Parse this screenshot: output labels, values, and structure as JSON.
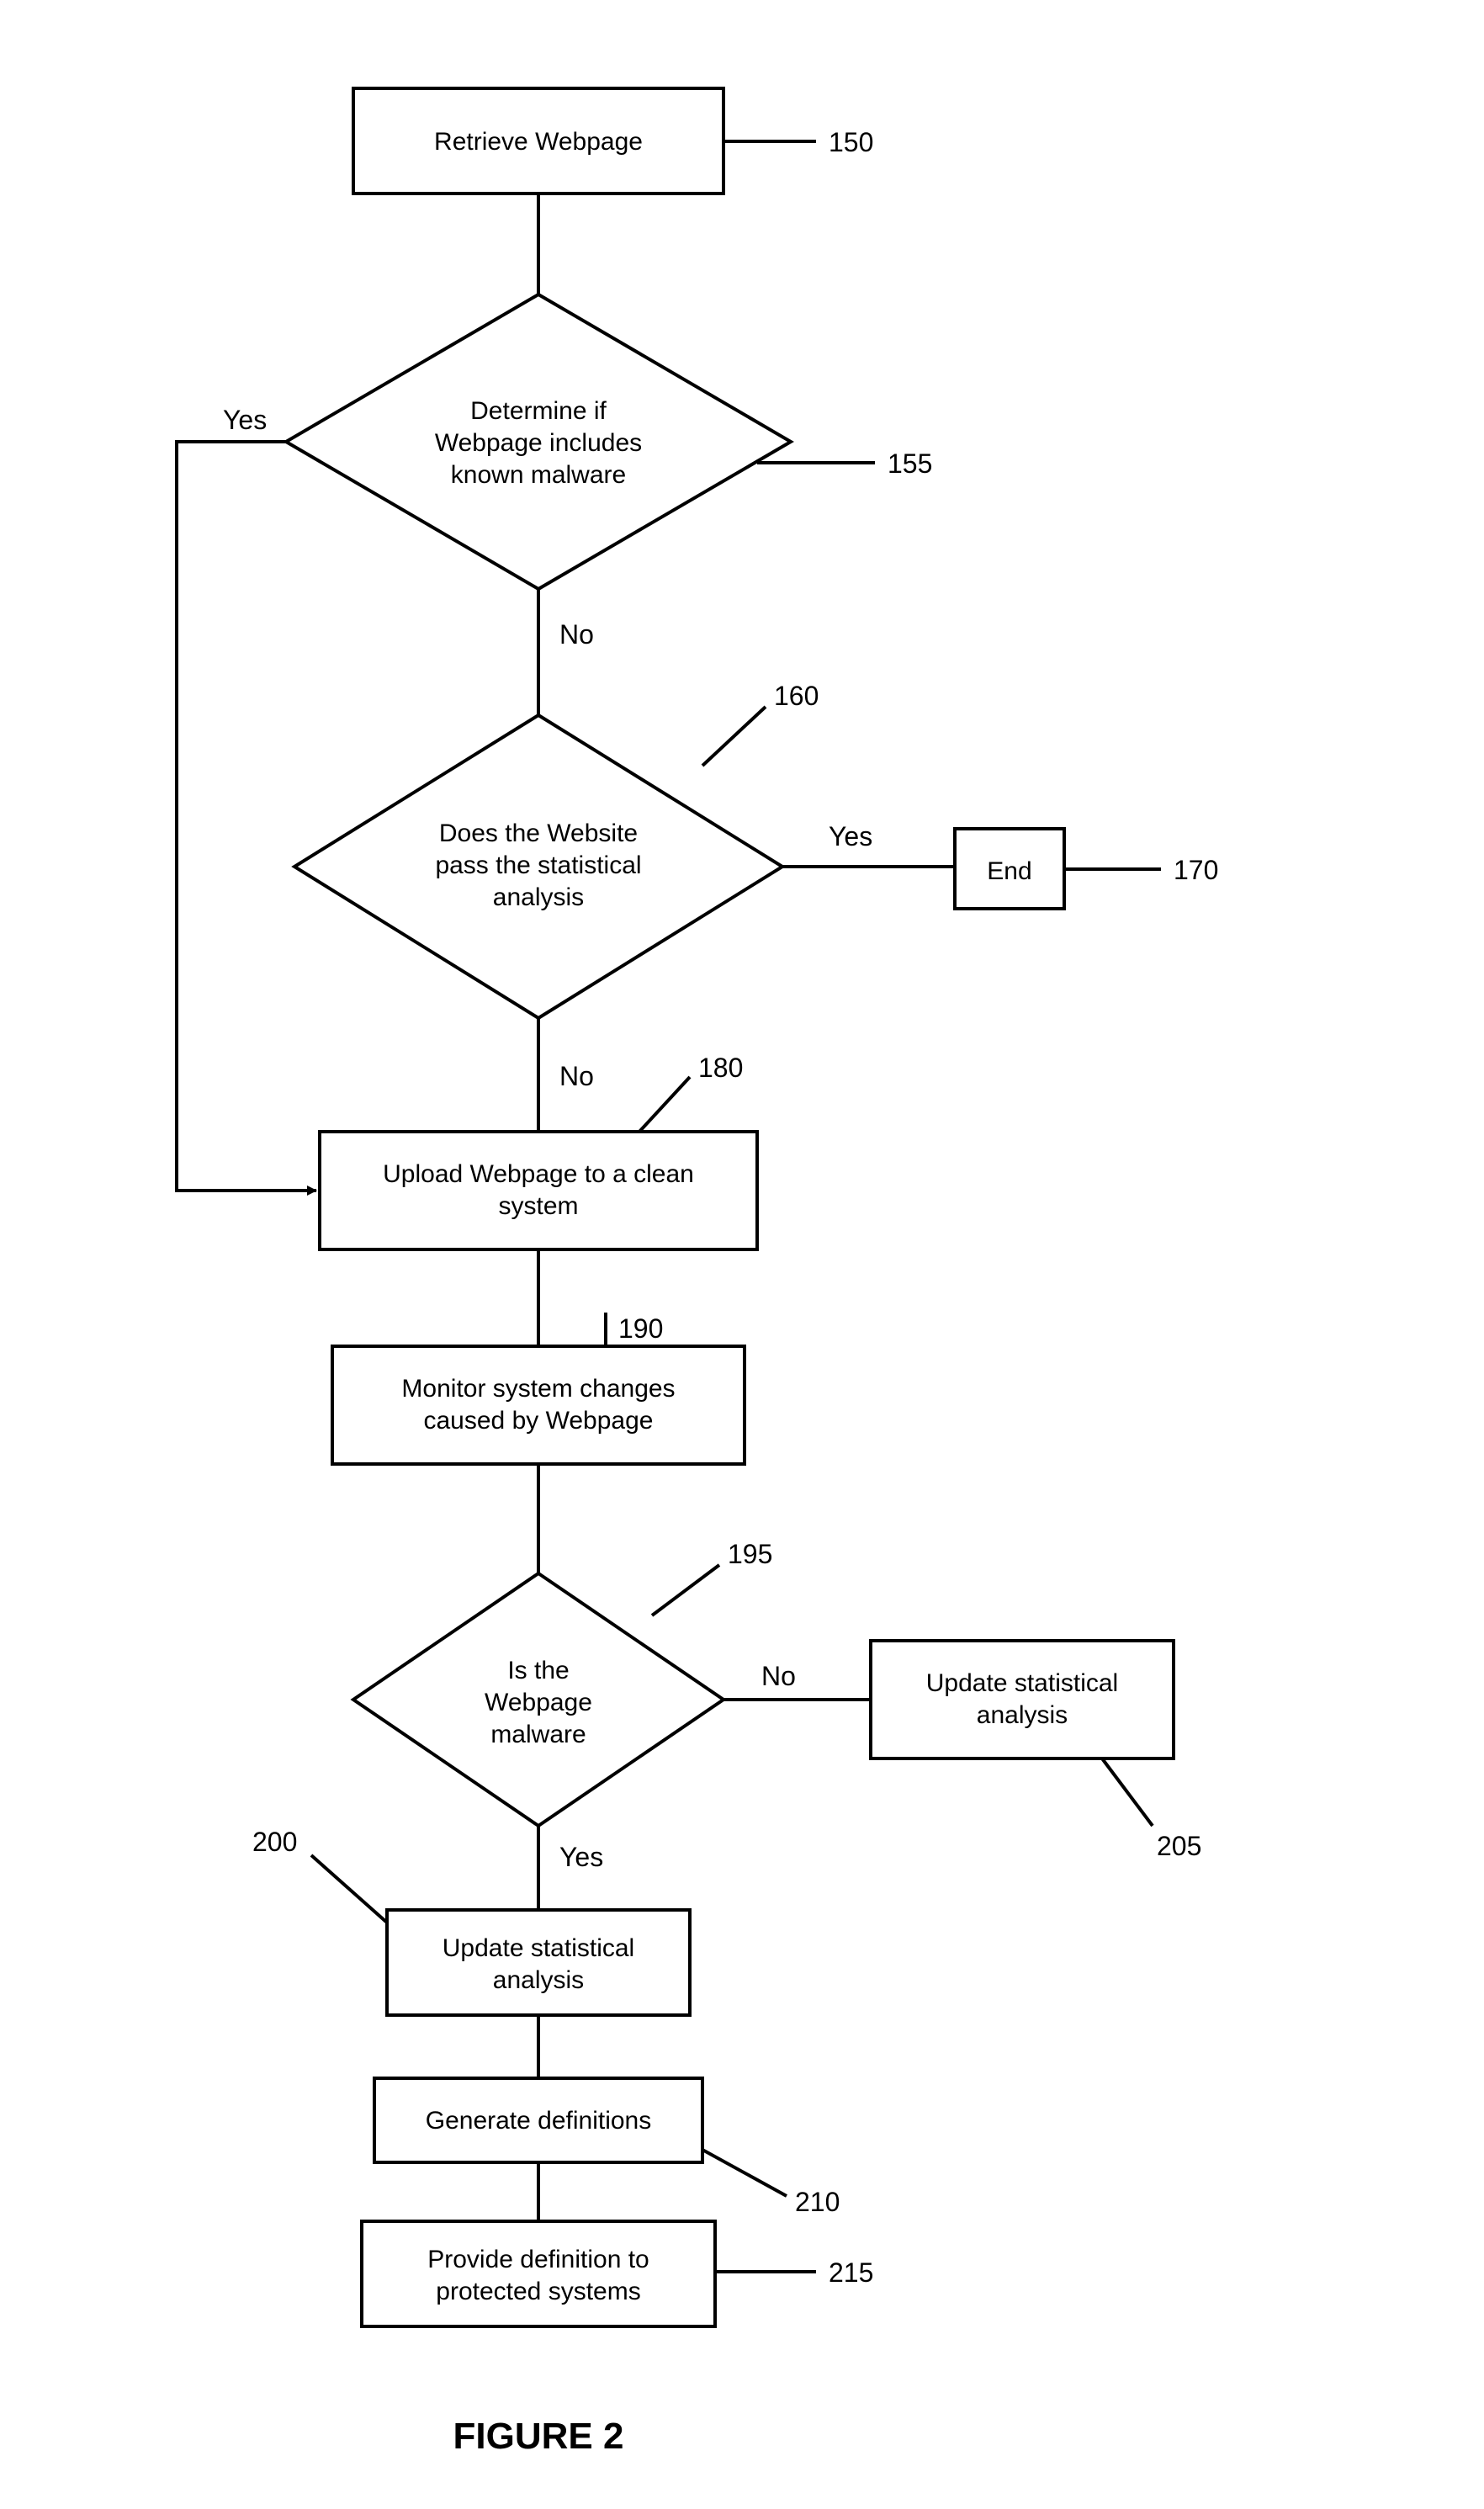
{
  "figure_label": "FIGURE 2",
  "nodes": {
    "n150": {
      "ref": "150",
      "text": "Retrieve Webpage"
    },
    "n155": {
      "ref": "155",
      "line1": "Determine if",
      "line2": "Webpage includes",
      "line3": "known malware"
    },
    "n160": {
      "ref": "160",
      "line1": "Does the Website",
      "line2": "pass the statistical",
      "line3": "analysis"
    },
    "n170": {
      "ref": "170",
      "text": "End"
    },
    "n180": {
      "ref": "180",
      "line1": "Upload Webpage to a clean",
      "line2": "system"
    },
    "n190": {
      "ref": "190",
      "line1": "Monitor system changes",
      "line2": "caused by Webpage"
    },
    "n195": {
      "ref": "195",
      "line1": "Is the",
      "line2": "Webpage",
      "line3": "malware"
    },
    "n200": {
      "ref": "200",
      "line1": "Update statistical",
      "line2": "analysis"
    },
    "n205": {
      "ref": "205",
      "line1": "Update statistical",
      "line2": "analysis"
    },
    "n210": {
      "ref": "210",
      "text": "Generate definitions"
    },
    "n215": {
      "ref": "215",
      "line1": "Provide definition to",
      "line2": "protected systems"
    }
  },
  "edge_labels": {
    "yes": "Yes",
    "no": "No"
  }
}
